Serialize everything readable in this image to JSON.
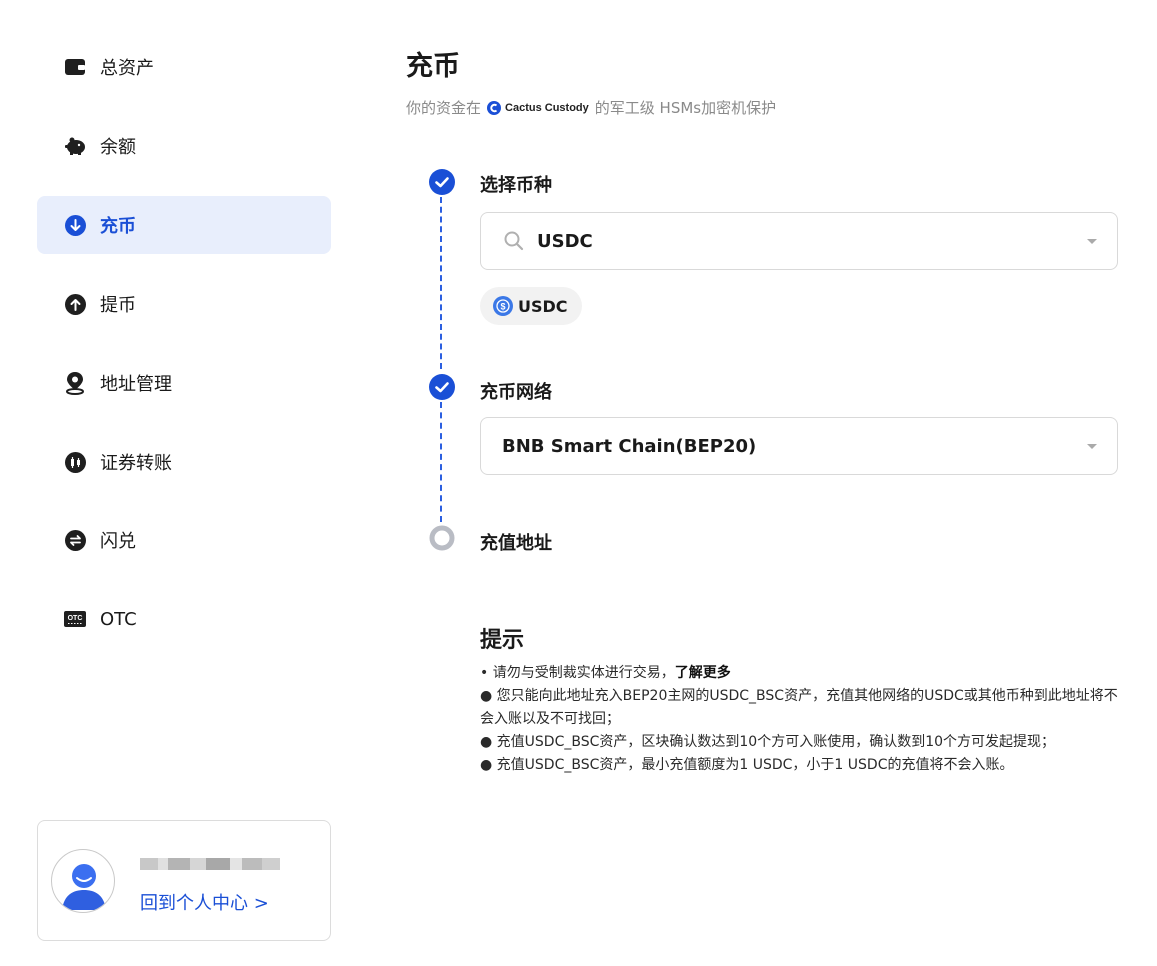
{
  "sidebar": {
    "items": [
      {
        "label": "总资产"
      },
      {
        "label": "余额"
      },
      {
        "label": "充币"
      },
      {
        "label": "提币"
      },
      {
        "label": "地址管理"
      },
      {
        "label": "证券转账"
      },
      {
        "label": "闪兑"
      },
      {
        "label": "OTC"
      }
    ],
    "otc_icon_text": "OTC",
    "back_label": "回到个人中心 >"
  },
  "main": {
    "title": "充币",
    "subtitle_before": "你的资金在",
    "brand_name": "Cactus Custody",
    "subtitle_after": "的军工级 HSMs加密机保护",
    "steps": [
      {
        "label": "选择币种",
        "status": "done"
      },
      {
        "label": "充币网络",
        "status": "done"
      },
      {
        "label": "充值地址",
        "status": "pending"
      }
    ],
    "coin_select": {
      "value": "USDC"
    },
    "coin_chip": {
      "label": "USDC"
    },
    "network_select": {
      "value": "BNB Smart Chain(BEP20)"
    }
  },
  "tips": {
    "title": "提示",
    "line1": "• 请勿与受制裁实体进行交易，",
    "learn_more": "了解更多",
    "line2": "● 您只能向此地址充入BEP20主网的USDC_BSC资产，充值其他网络的USDC或其他币种到此地址将不会入账以及不可找回；",
    "line3": "● 充值USDC_BSC资产，区块确认数达到10个方可入账使用，确认数到10个方可发起提现；",
    "line4": "● 充值USDC_BSC资产，最小充值额度为1 USDC，小于1  USDC的充值将不会入账。"
  },
  "colors": {
    "accent": "#1a4fd6",
    "active_bg": "#e8eefc",
    "step_done": "#1a4fd6",
    "step_pending": "#b9bcc4"
  }
}
